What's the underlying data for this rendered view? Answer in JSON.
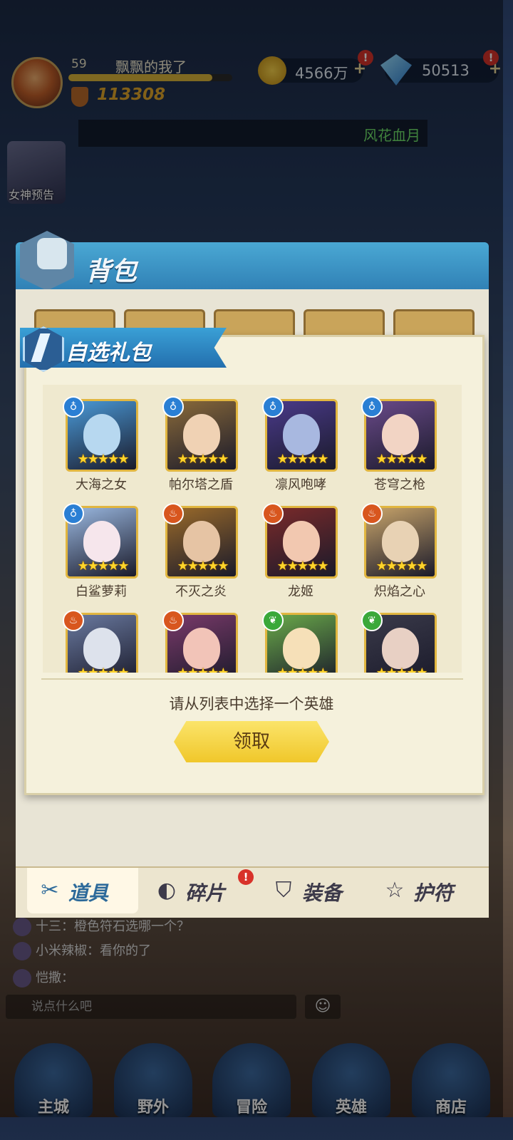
{
  "player": {
    "level": "59",
    "name": "飘飘的我了",
    "xp_fraction": 0.88,
    "power": "113308"
  },
  "resources": {
    "gold": "4566万",
    "gems": "50513",
    "plus": "+",
    "badge": "!"
  },
  "ticker": {
    "text": "风花血月"
  },
  "side_event": {
    "label": "女神预告"
  },
  "backpack": {
    "title": "背包",
    "tabs": [
      {
        "label": "道具",
        "icon": "scroll-icon",
        "glyph": "✂"
      },
      {
        "label": "碎片",
        "icon": "shard-icon",
        "glyph": "◐"
      },
      {
        "label": "装备",
        "icon": "armor-icon",
        "glyph": "⛉"
      },
      {
        "label": "护符",
        "icon": "star-icon",
        "glyph": "☆"
      }
    ]
  },
  "gift_dialog": {
    "title": "自选礼包",
    "stars": "★★★★★",
    "heroes": [
      {
        "name": "大海之女",
        "element": "water",
        "glyph": "♁",
        "elem_color": "#2a7fd4",
        "bg": "#4a9ad8",
        "face": "#b7d8f0"
      },
      {
        "name": "帕尔塔之盾",
        "element": "water",
        "glyph": "♁",
        "elem_color": "#2a7fd4",
        "bg": "#8a6a3a",
        "face": "#f0d2b4"
      },
      {
        "name": "凛风咆哮",
        "element": "water",
        "glyph": "♁",
        "elem_color": "#2a7fd4",
        "bg": "#4a3a8a",
        "face": "#a8b8e0"
      },
      {
        "name": "苍穹之枪",
        "element": "water",
        "glyph": "♁",
        "elem_color": "#2a7fd4",
        "bg": "#6a4a8a",
        "face": "#f2d4c4"
      },
      {
        "name": "白鲨萝莉",
        "element": "water",
        "glyph": "♁",
        "elem_color": "#2a7fd4",
        "bg": "#9ab8e0",
        "face": "#f6e6ec"
      },
      {
        "name": "不灭之炎",
        "element": "fire",
        "glyph": "♨",
        "elem_color": "#d8561e",
        "bg": "#9a6a2a",
        "face": "#e6c4a4"
      },
      {
        "name": "龙姬",
        "element": "fire",
        "glyph": "♨",
        "elem_color": "#d8561e",
        "bg": "#7a2a2a",
        "face": "#f2c8b0"
      },
      {
        "name": "炽焰之心",
        "element": "fire",
        "glyph": "♨",
        "elem_color": "#d8561e",
        "bg": "#c8a46a",
        "face": "#e8d2b4"
      },
      {
        "name": "",
        "element": "fire",
        "glyph": "♨",
        "elem_color": "#d8561e",
        "bg": "#6a7aa0",
        "face": "#dde2ec"
      },
      {
        "name": "",
        "element": "fire",
        "glyph": "♨",
        "elem_color": "#d8561e",
        "bg": "#7a3a6a",
        "face": "#f2c4b8"
      },
      {
        "name": "",
        "element": "wind",
        "glyph": "❦",
        "elem_color": "#3aa83a",
        "bg": "#6aaa4a",
        "face": "#f6e0b8"
      },
      {
        "name": "",
        "element": "wind",
        "glyph": "❦",
        "elem_color": "#3aa83a",
        "bg": "#3a3a4a",
        "face": "#e8d0c4"
      }
    ],
    "hint": "请从列表中选择一个英雄",
    "claim_label": "领取"
  },
  "chat": {
    "messages": [
      "十三：橙色符石选哪一个？",
      "小米辣椒：看你的了",
      "恺撒："
    ],
    "input_placeholder": "说点什么吧",
    "emoji": "☺"
  },
  "bottom_nav": [
    {
      "label": "主城"
    },
    {
      "label": "野外"
    },
    {
      "label": "冒险"
    },
    {
      "label": "英雄"
    },
    {
      "label": "商店"
    }
  ]
}
